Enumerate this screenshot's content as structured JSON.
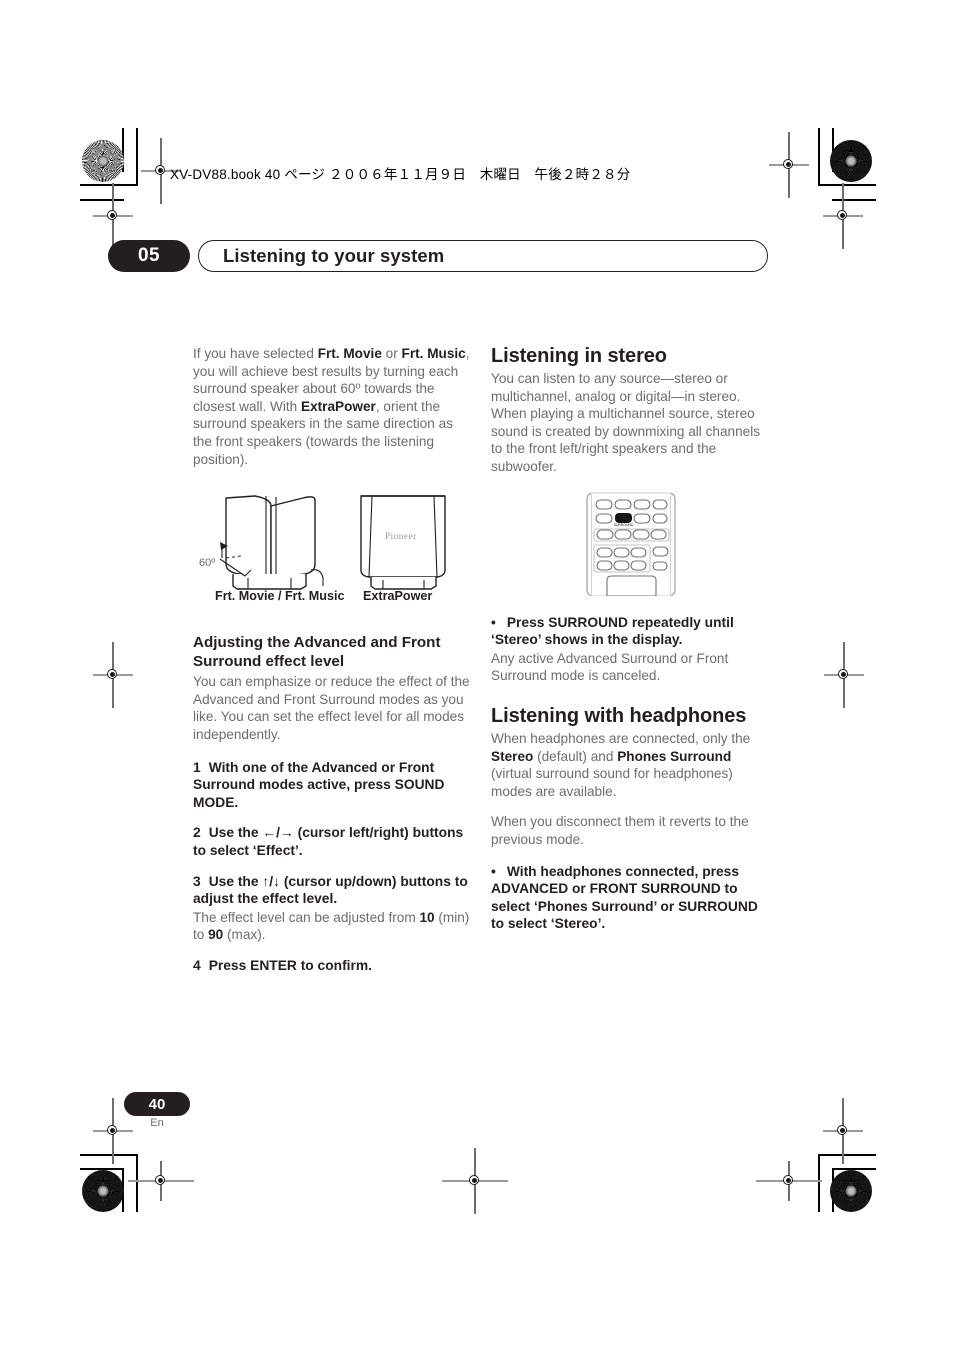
{
  "print_header": {
    "text": "XV-DV88.book  40 ページ  ２００６年１１月９日　木曜日　午後２時２８分"
  },
  "chapter": {
    "number": "05",
    "title": "Listening to your system"
  },
  "left_column": {
    "intro_html": "If you have selected <b>Frt. Movie</b> or <b>Frt. Music</b>, you will achieve best results by turning each surround speaker about 60º towards the closest wall. With <b>ExtraPower</b>, orient the surround speakers in the same direction as the front speakers (towards the listening position).",
    "figure": {
      "angle_label": "60º",
      "caption_left": "Frt. Movie / Frt. Music",
      "caption_right": "ExtraPower",
      "speaker_brand": "Pioneer"
    },
    "subheading": "Adjusting the Advanced and Front Surround effect level",
    "sub_body": "You can emphasize or reduce the effect of the Advanced and Front Surround modes as you like. You can set the effect level for all modes independently.",
    "steps": [
      {
        "num": "1",
        "text_html": "With one of the Advanced or Front Surround modes active, press SOUND MODE."
      },
      {
        "num": "2",
        "text_html": "Use the ←/→ (cursor left/right) buttons to select ‘Effect’."
      },
      {
        "num": "3",
        "text_html": "Use the ↑/↓ (cursor up/down) buttons to adjust the effect level."
      },
      {
        "num": "4",
        "text_html": "Press ENTER to confirm."
      }
    ],
    "step3_note_html": "The effect level can be adjusted from <b>10</b> (min) to <b>90</b> (max)."
  },
  "right_column": {
    "stereo_heading": "Listening in stereo",
    "stereo_body": "You can listen to any source—stereo or multichannel, analog or digital—in stereo. When playing a multichannel source, stereo sound is created by downmixing all channels to the front left/right speakers and the subwoofer.",
    "remote_button_label": "SURROUND",
    "stereo_bullet_html": "Press SURROUND repeatedly until ‘Stereo’ shows in the display.",
    "stereo_bullet_note": "Any active Advanced Surround or Front Surround mode is canceled.",
    "headphones_heading": "Listening with headphones",
    "headphones_body_html": "When headphones are connected, only the <b>Stereo</b> (default) and <b>Phones Surround</b> (virtual surround sound for headphones) modes are available.",
    "headphones_body2": "When you disconnect them it reverts to the previous mode.",
    "headphones_bullet_html": "With headphones connected, press ADVANCED or FRONT SURROUND to select ‘Phones Surround’ or SURROUND to select ‘Stereo’."
  },
  "footer": {
    "page_number": "40",
    "language": "En"
  },
  "colors": {
    "ink": "#231f20",
    "body_text": "#6c6d70",
    "page_bg": "#ffffff"
  }
}
